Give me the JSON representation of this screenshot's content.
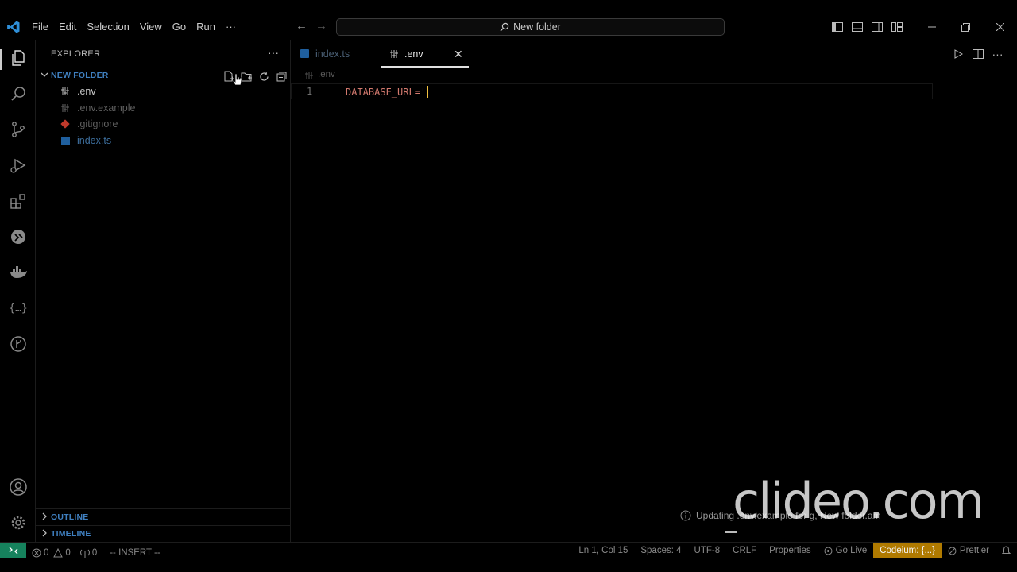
{
  "titlebar": {
    "menu": [
      "File",
      "Edit",
      "Selection",
      "View",
      "Go",
      "Run",
      "···"
    ],
    "search_text": "New folder"
  },
  "sidebar": {
    "title": "EXPLORER",
    "more": "···",
    "folder": "NEW FOLDER",
    "files": [
      {
        "name": ".env",
        "icon": "settings-file-icon",
        "color": "#c8c8c8"
      },
      {
        "name": ".env.example",
        "icon": "settings-file-icon",
        "color": "#5f5f5f"
      },
      {
        "name": ".gitignore",
        "icon": "git-icon",
        "color": "#5f5f5f"
      },
      {
        "name": "index.ts",
        "icon": "typescript-icon",
        "color": "#5f5f5f"
      }
    ],
    "outline": "OUTLINE",
    "timeline": "TIMELINE"
  },
  "editor": {
    "tabs": [
      {
        "label": "index.ts",
        "active": false
      },
      {
        "label": ".env",
        "active": true
      }
    ],
    "breadcrumb": ".env",
    "line_number": "1",
    "code_key": "DATABASE_URL=",
    "code_quote": "'"
  },
  "notification": {
    "text": "Updating .env.example for g, New folder.am"
  },
  "watermark": "clideo.com",
  "statusbar": {
    "errors": "0",
    "warnings": "0",
    "ports": "0",
    "mode": "-- INSERT --",
    "position": "Ln 1, Col 15",
    "spaces": "Spaces: 4",
    "encoding": "UTF-8",
    "eol": "CRLF",
    "language": "Properties",
    "golive": "Go Live",
    "codeium": "Codeium: {...}",
    "prettier": "Prettier"
  },
  "colors": {
    "accent_folder": "#3f7fbf",
    "remote": "#16825d",
    "codeium_bg": "#b07a00",
    "code_key": "#d47a6f",
    "cursor": "#f0c040"
  }
}
